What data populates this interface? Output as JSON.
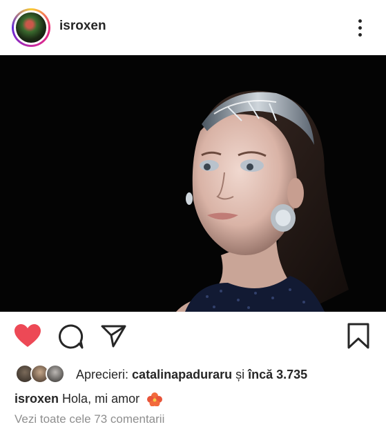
{
  "header": {
    "username": "isroxen",
    "avatar_icon": "profile-avatar",
    "more_icon": "more-vertical-icon"
  },
  "post": {
    "image_description_icon": "post-photo"
  },
  "actions": {
    "like_icon": "heart-filled-icon",
    "like_color": "#ed4956",
    "comment_icon": "comment-icon",
    "share_icon": "direct-send-icon",
    "save_icon": "bookmark-icon"
  },
  "likes": {
    "prefix": "Aprecieri:",
    "liked_by": "catalinapaduraru",
    "separator": "și",
    "others": "încă 3.735"
  },
  "caption": {
    "username": "isroxen",
    "text": "Hola, mi amor"
  },
  "comments": {
    "view_all": "Vezi toate cele 73 comentarii"
  }
}
